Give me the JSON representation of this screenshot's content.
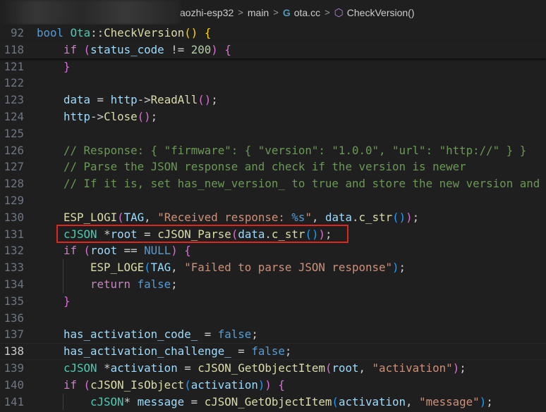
{
  "breadcrumb": {
    "folder": "aozhi-esp32",
    "subfolder": "main",
    "file": "ota.cc",
    "symbol": "CheckVersion()",
    "file_icon": "cpp-icon",
    "symbol_icon": "method-cube-icon",
    "separator": ">"
  },
  "editor": {
    "active_line": "138",
    "lines": [
      {
        "n": "92",
        "sticky": true,
        "indent": 0,
        "tokens": [
          [
            "kw",
            "bool "
          ],
          [
            "type",
            "Ota"
          ],
          [
            "pl",
            "::"
          ],
          [
            "fn",
            "CheckVersion"
          ],
          [
            "b1",
            "()"
          ],
          [
            "pl",
            " "
          ],
          [
            "b1",
            "{"
          ]
        ]
      },
      {
        "n": "118",
        "sticky": true,
        "indent": 1,
        "tokens": [
          [
            "ctrl",
            "if "
          ],
          [
            "b2",
            "("
          ],
          [
            "var",
            "status_code"
          ],
          [
            "pl",
            " != "
          ],
          [
            "num",
            "200"
          ],
          [
            "b2",
            ")"
          ],
          [
            "pl",
            " "
          ],
          [
            "b2",
            "{"
          ]
        ]
      },
      {
        "n": "121",
        "indent": 1,
        "tokens": [
          [
            "b2",
            "}"
          ]
        ]
      },
      {
        "n": "122",
        "indent": 0,
        "tokens": []
      },
      {
        "n": "123",
        "indent": 1,
        "tokens": [
          [
            "var",
            "data"
          ],
          [
            "pl",
            " = "
          ],
          [
            "var",
            "http"
          ],
          [
            "pl",
            "->"
          ],
          [
            "fn",
            "ReadAll"
          ],
          [
            "b2",
            "()"
          ],
          [
            "pl",
            ";"
          ]
        ]
      },
      {
        "n": "124",
        "indent": 1,
        "tokens": [
          [
            "var",
            "http"
          ],
          [
            "pl",
            "->"
          ],
          [
            "fn",
            "Close"
          ],
          [
            "b2",
            "()"
          ],
          [
            "pl",
            ";"
          ]
        ]
      },
      {
        "n": "125",
        "indent": 0,
        "tokens": []
      },
      {
        "n": "126",
        "indent": 1,
        "tokens": [
          [
            "com",
            "// Response: { \"firmware\": { \"version\": \"1.0.0\", \"url\": \"http://\" } }"
          ]
        ]
      },
      {
        "n": "127",
        "indent": 1,
        "tokens": [
          [
            "com",
            "// Parse the JSON response and check if the version is newer"
          ]
        ]
      },
      {
        "n": "128",
        "indent": 1,
        "tokens": [
          [
            "com",
            "// If it is, set has_new_version_ to true and store the new version and"
          ]
        ]
      },
      {
        "n": "129",
        "indent": 0,
        "tokens": []
      },
      {
        "n": "130",
        "indent": 1,
        "tokens": [
          [
            "fn",
            "ESP_LOGI"
          ],
          [
            "b2",
            "("
          ],
          [
            "var",
            "TAG"
          ],
          [
            "pl",
            ", "
          ],
          [
            "str",
            "\"Received response: "
          ],
          [
            "esc",
            "%s"
          ],
          [
            "str",
            "\""
          ],
          [
            "pl",
            ", "
          ],
          [
            "var",
            "data"
          ],
          [
            "pl",
            "."
          ],
          [
            "fn",
            "c_str"
          ],
          [
            "b3",
            "()"
          ],
          [
            "b2",
            ")"
          ],
          [
            "pl",
            ";"
          ]
        ]
      },
      {
        "n": "131",
        "indent": 1,
        "tokens": [
          [
            "type",
            "cJSON"
          ],
          [
            "pl",
            " *"
          ],
          [
            "var",
            "root"
          ],
          [
            "pl",
            " = "
          ],
          [
            "fn",
            "cJSON_Parse"
          ],
          [
            "b2",
            "("
          ],
          [
            "var",
            "data"
          ],
          [
            "pl",
            "."
          ],
          [
            "fn",
            "c_str"
          ],
          [
            "b3",
            "()"
          ],
          [
            "b2",
            ")"
          ],
          [
            "pl",
            ";"
          ]
        ]
      },
      {
        "n": "132",
        "indent": 1,
        "tokens": [
          [
            "ctrl",
            "if "
          ],
          [
            "b2",
            "("
          ],
          [
            "var",
            "root"
          ],
          [
            "pl",
            " == "
          ],
          [
            "kw",
            "NULL"
          ],
          [
            "b2",
            ")"
          ],
          [
            "pl",
            " "
          ],
          [
            "b2",
            "{"
          ]
        ]
      },
      {
        "n": "133",
        "indent": 2,
        "tokens": [
          [
            "fn",
            "ESP_LOGE"
          ],
          [
            "b3",
            "("
          ],
          [
            "var",
            "TAG"
          ],
          [
            "pl",
            ", "
          ],
          [
            "str",
            "\"Failed to parse JSON response\""
          ],
          [
            "b3",
            ")"
          ],
          [
            "pl",
            ";"
          ]
        ]
      },
      {
        "n": "134",
        "indent": 2,
        "tokens": [
          [
            "ctrl",
            "return "
          ],
          [
            "kw",
            "false"
          ],
          [
            "pl",
            ";"
          ]
        ]
      },
      {
        "n": "135",
        "indent": 1,
        "tokens": [
          [
            "b2",
            "}"
          ]
        ]
      },
      {
        "n": "136",
        "indent": 0,
        "tokens": []
      },
      {
        "n": "137",
        "indent": 1,
        "tokens": [
          [
            "var",
            "has_activation_code_"
          ],
          [
            "pl",
            " = "
          ],
          [
            "kw",
            "false"
          ],
          [
            "pl",
            ";"
          ]
        ]
      },
      {
        "n": "138",
        "indent": 1,
        "tokens": [
          [
            "var",
            "has_activation_challenge_"
          ],
          [
            "pl",
            " = "
          ],
          [
            "kw",
            "false"
          ],
          [
            "pl",
            ";"
          ]
        ]
      },
      {
        "n": "139",
        "indent": 1,
        "tokens": [
          [
            "type",
            "cJSON"
          ],
          [
            "pl",
            " *"
          ],
          [
            "var",
            "activation"
          ],
          [
            "pl",
            " = "
          ],
          [
            "fn",
            "cJSON_GetObjectItem"
          ],
          [
            "b2",
            "("
          ],
          [
            "var",
            "root"
          ],
          [
            "pl",
            ", "
          ],
          [
            "str",
            "\"activation\""
          ],
          [
            "b2",
            ")"
          ],
          [
            "pl",
            ";"
          ]
        ]
      },
      {
        "n": "140",
        "indent": 1,
        "tokens": [
          [
            "ctrl",
            "if "
          ],
          [
            "b2",
            "("
          ],
          [
            "fn",
            "cJSON_IsObject"
          ],
          [
            "b3",
            "("
          ],
          [
            "var",
            "activation"
          ],
          [
            "b3",
            ")"
          ],
          [
            "b2",
            ")"
          ],
          [
            "pl",
            " "
          ],
          [
            "b2",
            "{"
          ]
        ]
      },
      {
        "n": "141",
        "indent": 2,
        "tokens": [
          [
            "type",
            "cJSON"
          ],
          [
            "pl",
            "* "
          ],
          [
            "var",
            "message"
          ],
          [
            "pl",
            " = "
          ],
          [
            "fn",
            "cJSON_GetObjectItem"
          ],
          [
            "b3",
            "("
          ],
          [
            "var",
            "activation"
          ],
          [
            "pl",
            ", "
          ],
          [
            "str",
            "\"message\""
          ],
          [
            "b3",
            ")"
          ],
          [
            "pl",
            ";"
          ]
        ]
      }
    ]
  },
  "colors": {
    "background": "#1f1f1f",
    "highlight_border": "#e0261f"
  }
}
